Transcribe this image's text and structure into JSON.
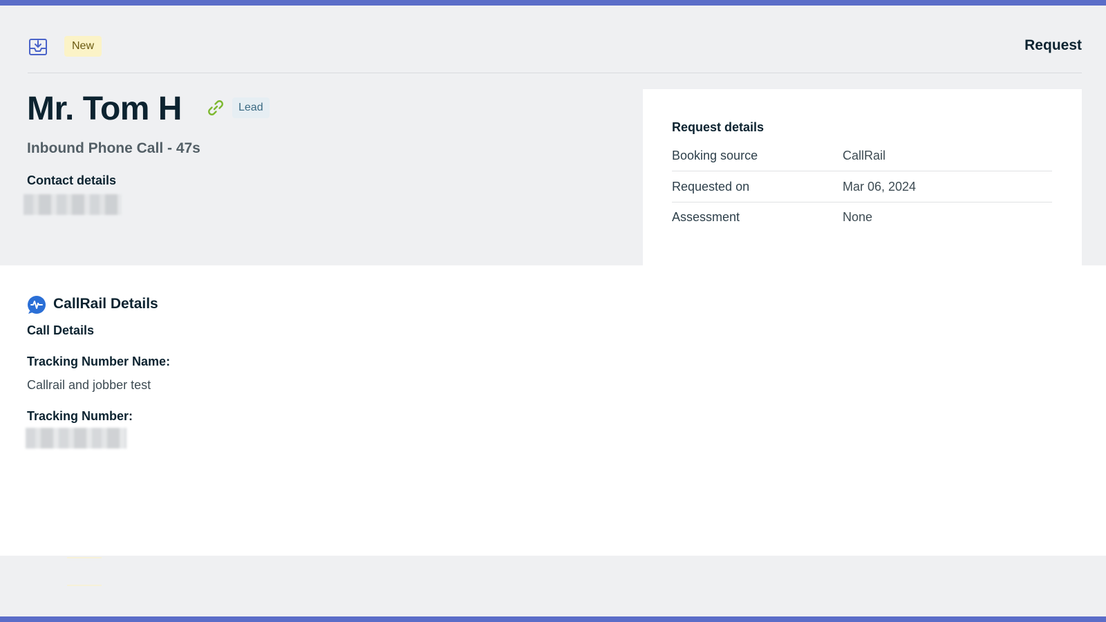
{
  "header": {
    "status_badge": "New",
    "title": "Request",
    "icon": "inbox-download-icon"
  },
  "client": {
    "name": "Mr. Tom H",
    "type_badge": "Lead",
    "link_icon": "link-icon",
    "subtitle": "Inbound Phone Call - 47s",
    "contact_heading": "Contact details"
  },
  "request_details": {
    "heading": "Request details",
    "rows": [
      {
        "label": "Booking source",
        "value": "CallRail"
      },
      {
        "label": "Requested on",
        "value": "Mar 06, 2024"
      },
      {
        "label": "Assessment",
        "value": "None"
      }
    ]
  },
  "callrail": {
    "icon": "callrail-icon",
    "title": "CallRail Details",
    "section": "Call Details",
    "tracking_number_name_label": "Tracking Number Name:",
    "tracking_number_name_value": "Callrail and jobber test",
    "tracking_number_label": "Tracking Number:"
  },
  "colors": {
    "accent_bar": "#5b6dc8",
    "new_badge_bg": "#fbf3c7",
    "lead_badge_bg": "#e6eef3",
    "link_icon": "#7db82f",
    "callrail_icon": "#2b6fd6"
  }
}
